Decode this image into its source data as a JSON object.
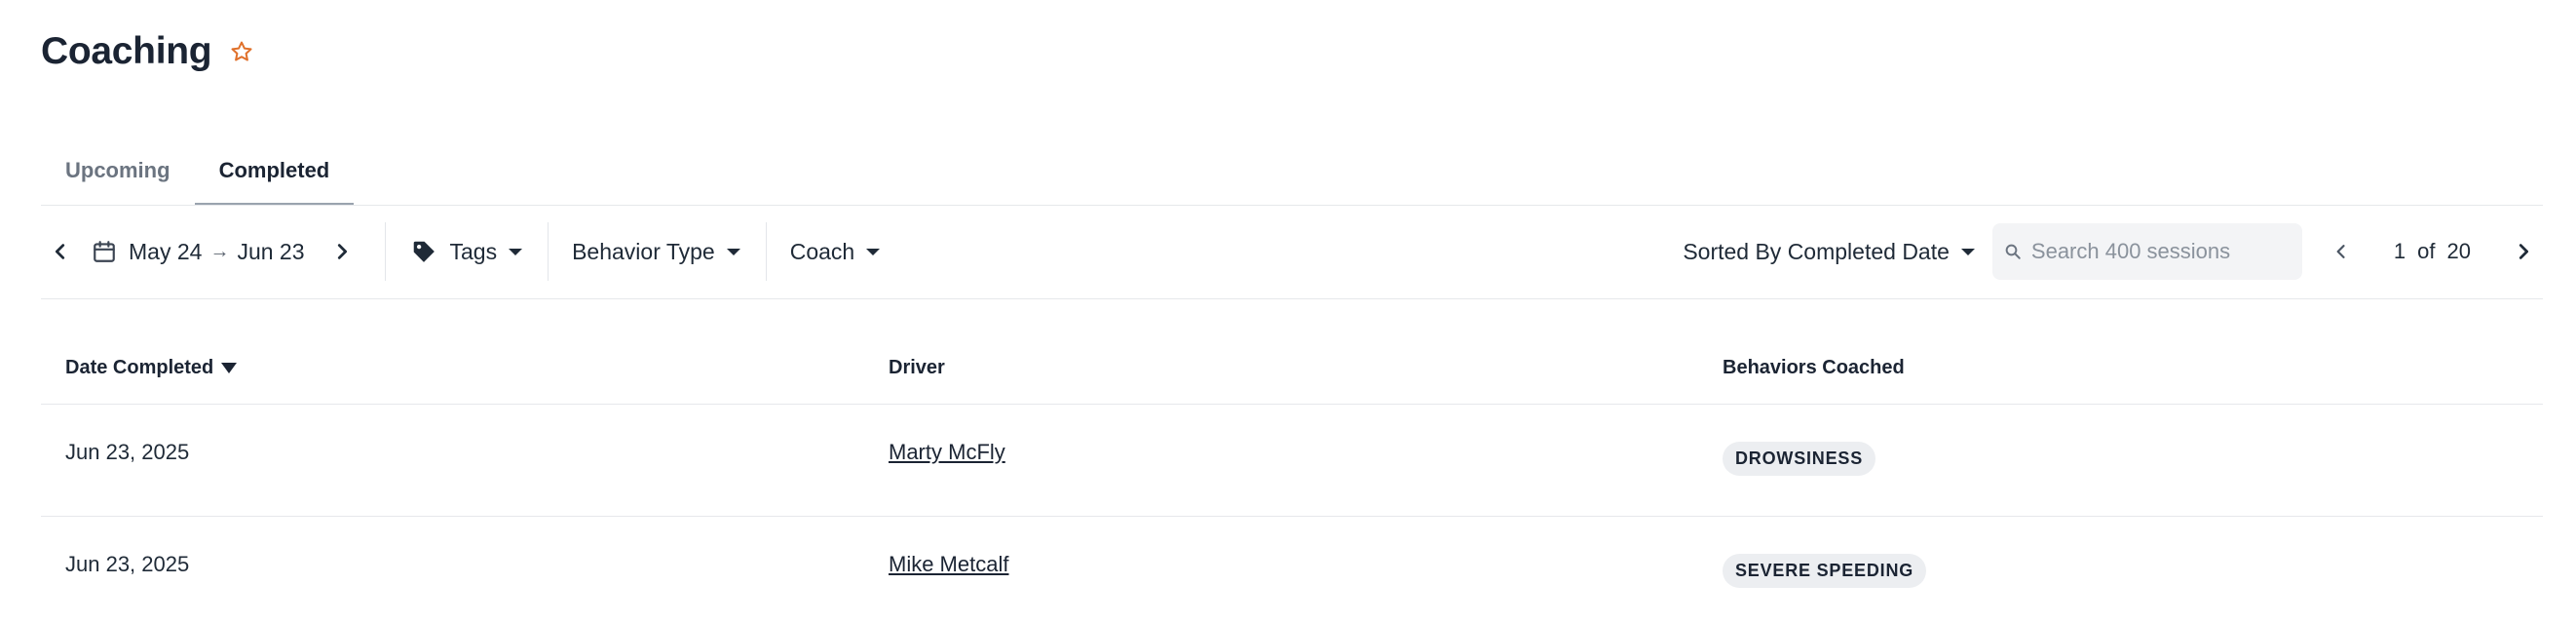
{
  "header": {
    "title": "Coaching",
    "favorite_icon": "star-outline-icon",
    "favorite_color": "#e0702a"
  },
  "tabs": [
    {
      "label": "Upcoming",
      "active": false
    },
    {
      "label": "Completed",
      "active": true
    }
  ],
  "toolbar": {
    "date_range": {
      "start": "May 24",
      "end": "Jun 23"
    },
    "filters": {
      "tags": "Tags",
      "behavior_type": "Behavior Type",
      "coach": "Coach"
    },
    "sort_label": "Sorted By Completed Date",
    "search_placeholder": "Search 400 sessions",
    "pagination": {
      "current": "1",
      "of": "of",
      "total": "20"
    }
  },
  "table": {
    "columns": [
      "Date Completed",
      "Driver",
      "Behaviors Coached"
    ],
    "rows": [
      {
        "date": "Jun 23, 2025",
        "driver": "Marty McFly",
        "behavior": "DROWSINESS"
      },
      {
        "date": "Jun 23, 2025",
        "driver": "Mike Metcalf",
        "behavior": "SEVERE SPEEDING"
      }
    ]
  }
}
